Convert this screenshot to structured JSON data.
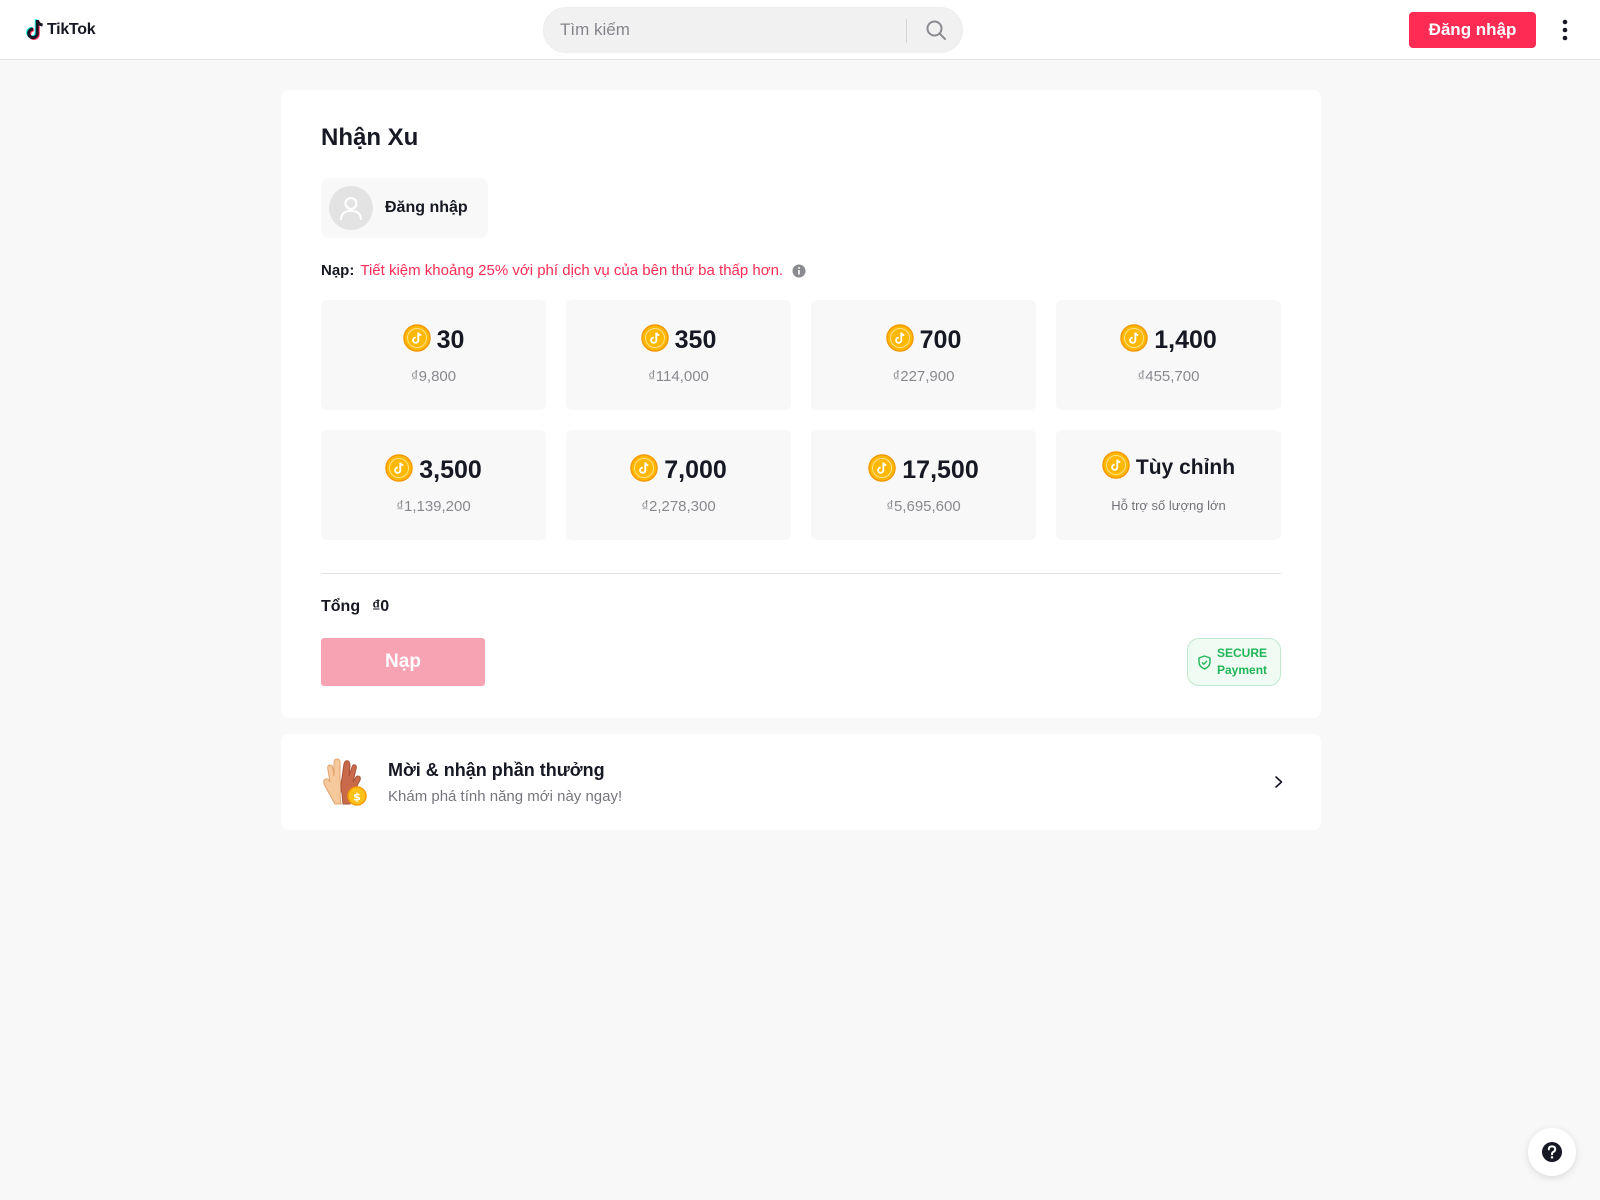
{
  "header": {
    "logo_text": "TikTok",
    "search_placeholder": "Tìm kiếm",
    "login_label": "Đăng nhập"
  },
  "card": {
    "title": "Nhận Xu",
    "account_label": "Đăng nhập",
    "notice_label": "Nạp:",
    "notice_text": "Tiết kiệm khoảng 25% với phí dịch vụ của bên thứ ba thấp hơn.",
    "packages": [
      {
        "amount": "30",
        "price": "₫9,800"
      },
      {
        "amount": "350",
        "price": "₫114,000"
      },
      {
        "amount": "700",
        "price": "₫227,900"
      },
      {
        "amount": "1,400",
        "price": "₫455,700"
      },
      {
        "amount": "3,500",
        "price": "₫1,139,200"
      },
      {
        "amount": "7,000",
        "price": "₫2,278,300"
      },
      {
        "amount": "17,500",
        "price": "₫5,695,600"
      }
    ],
    "custom": {
      "label": "Tùy chỉnh",
      "sub": "Hỗ trợ số lượng lớn"
    },
    "total_label": "Tổng",
    "total_value": "₫0",
    "recharge_label": "Nạp",
    "secure_line1": "SECURE",
    "secure_line2": "Payment"
  },
  "invite": {
    "title": "Mời & nhận phần thưởng",
    "subtitle": "Khám phá tính năng mới này ngay!"
  },
  "colors": {
    "brand": "#fe2c55",
    "recharge_disabled": "#f8a3b4",
    "coin": "#ffb800",
    "secure_green": "#21b559"
  },
  "icons": [
    "tiktok-logo-icon",
    "search-icon",
    "more-vertical-icon",
    "user-avatar-icon",
    "info-icon",
    "coin-icon",
    "shield-icon",
    "high-five-icon",
    "chevron-right-icon",
    "help-icon"
  ]
}
